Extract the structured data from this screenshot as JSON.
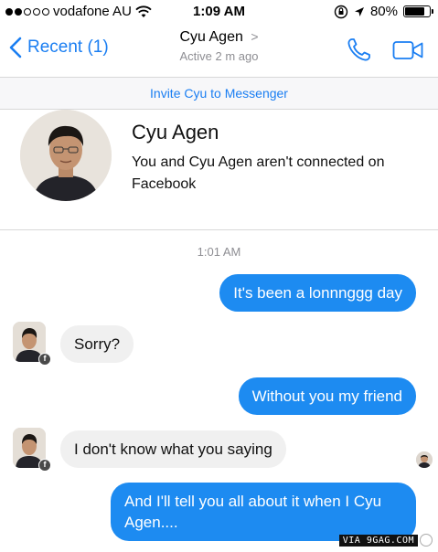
{
  "status_bar": {
    "carrier": "vodafone AU",
    "time": "1:09 AM",
    "battery_percent": "80%",
    "battery_level": 0.8,
    "icons": [
      "signal-dots-icon",
      "wifi-icon",
      "lock-rotation-icon",
      "location-arrow-icon",
      "battery-icon"
    ]
  },
  "nav": {
    "back_label": "Recent (1)",
    "title": "Cyu Agen",
    "title_chevron": ">",
    "subtitle": "Active 2 m ago",
    "icons": [
      "chevron-left-icon",
      "phone-icon",
      "video-camera-icon"
    ]
  },
  "invite_banner": "Invite Cyu to Messenger",
  "profile": {
    "name": "Cyu Agen",
    "note": "You and Cyu Agen aren't connected on Facebook"
  },
  "conversation": {
    "timestamp": "1:01 AM",
    "messages": [
      {
        "direction": "outgoing",
        "text": "It's been a lonnnggg day"
      },
      {
        "direction": "incoming",
        "text": "Sorry?"
      },
      {
        "direction": "outgoing",
        "text": "Without you my friend"
      },
      {
        "direction": "incoming",
        "text": "I don't know what you saying"
      },
      {
        "direction": "outgoing",
        "text": "And I'll tell you all about it when I Cyu Agen...."
      }
    ]
  },
  "watermark": "VIA 9GAG.COM",
  "colors": {
    "accent": "#1a7ef2",
    "outgoing_bubble": "#1d8bf1",
    "incoming_bubble": "#f0f0f0",
    "secondary_text": "#8e8e93"
  }
}
